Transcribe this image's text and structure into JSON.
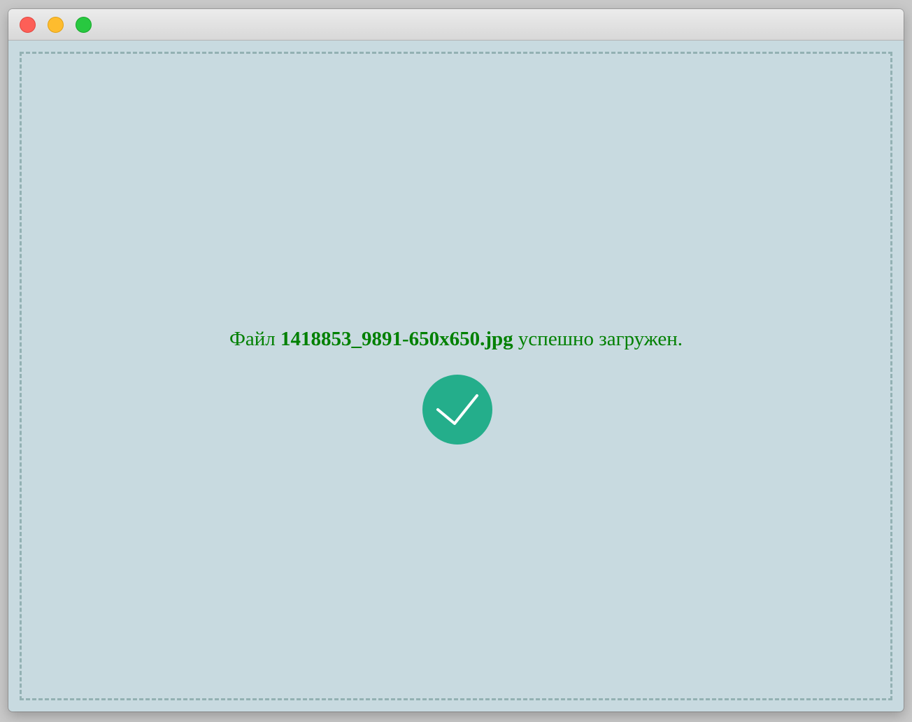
{
  "window": {
    "controls": {
      "close": "close-icon",
      "minimize": "minimize-icon",
      "maximize": "maximize-icon"
    }
  },
  "upload": {
    "prefix": "Файл",
    "filename": "1418853_9891-650x650.jpg",
    "suffix": "успешно загружен.",
    "status_icon": "checkmark-icon"
  },
  "colors": {
    "message": "#008000",
    "success_circle": "#24ae8b",
    "dropzone_background": "#c8dae0",
    "dropzone_border": "#93b1b3"
  }
}
